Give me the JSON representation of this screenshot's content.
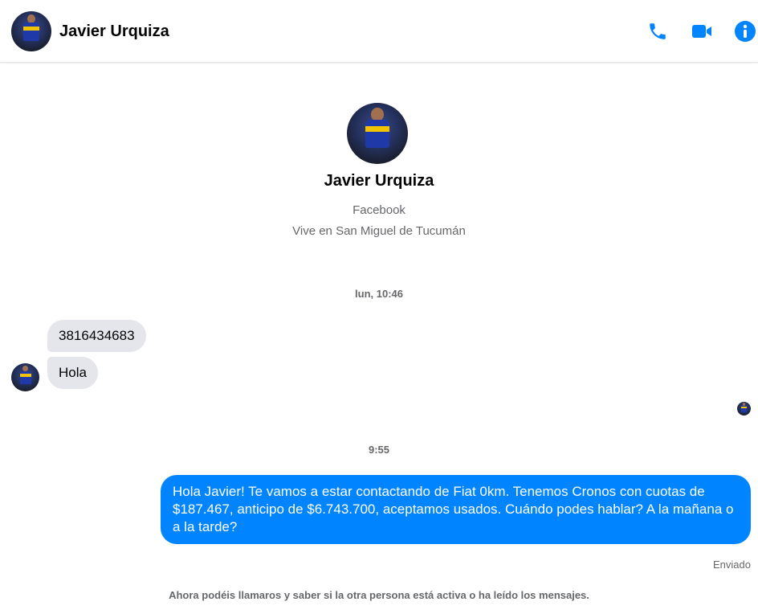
{
  "contact": {
    "name": "Javier Urquiza"
  },
  "header": {
    "name": "Javier Urquiza",
    "icons": [
      "phone-icon",
      "video-icon",
      "info-icon"
    ],
    "accent_color": "#0084ff"
  },
  "profile": {
    "name": "Javier Urquiza",
    "platform": "Facebook",
    "location": "Vive en San Miguel de Tucumán"
  },
  "conversation": {
    "timestamp_1": "lun, 10:46",
    "incoming": [
      {
        "text": "3816434683"
      },
      {
        "text": "Hola"
      }
    ],
    "timestamp_2": "9:55",
    "outgoing": {
      "text": "Hola Javier! Te vamos a estar contactando de Fiat 0km. Tenemos Cronos con cuotas de $187.467, anticipo de $6.743.700, aceptamos usados. Cuándo podes hablar? A la mañana o a la tarde?",
      "status": "Enviado"
    },
    "footer_note": "Ahora podéis llamaros y saber si la otra persona está activa o ha leído los mensajes."
  }
}
